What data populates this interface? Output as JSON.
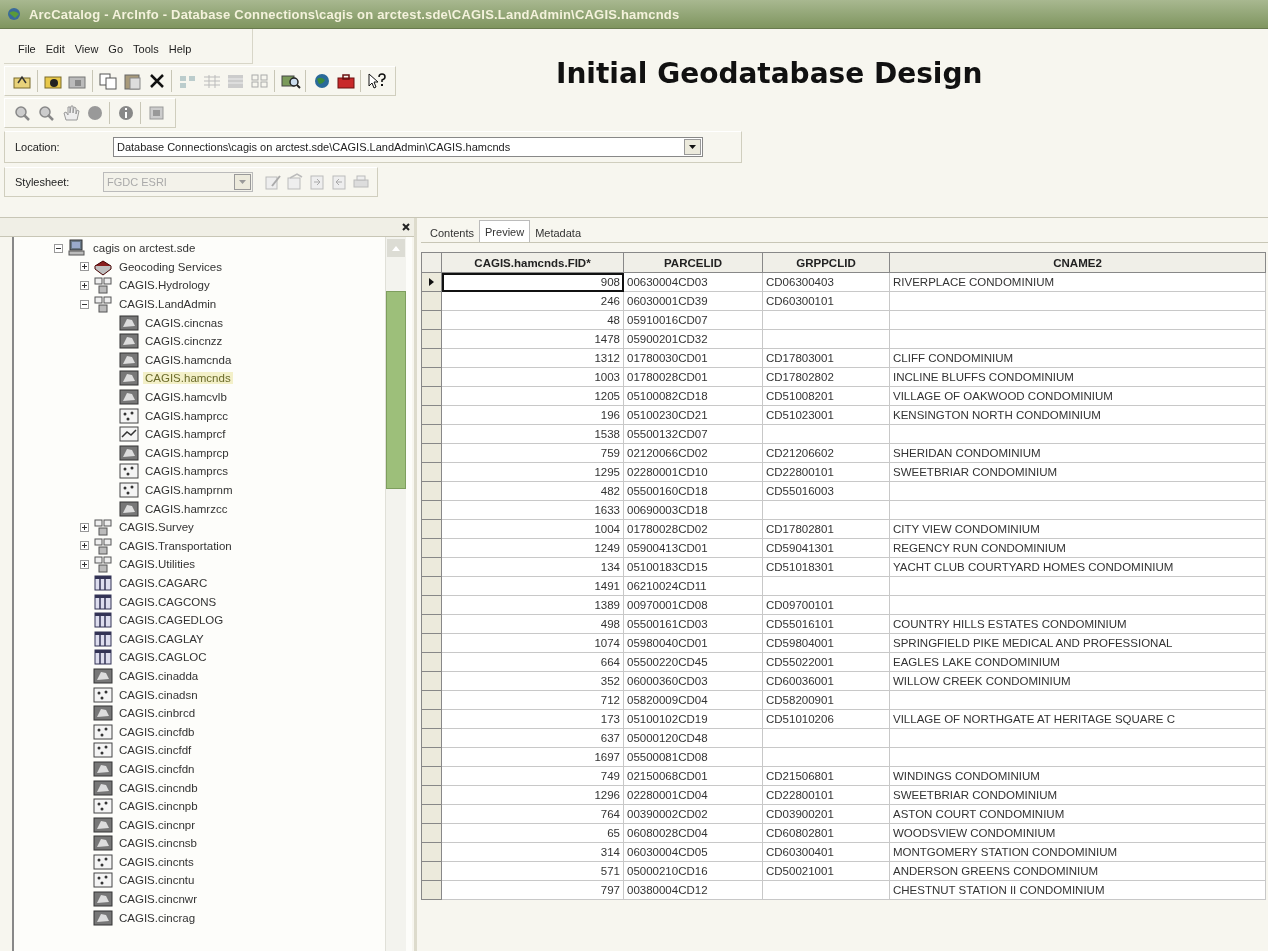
{
  "window": {
    "title": "ArcCatalog - ArcInfo - Database Connections\\cagis on arctest.sde\\CAGIS.LandAdmin\\CAGIS.hamcnds"
  },
  "menu": [
    "File",
    "Edit",
    "View",
    "Go",
    "Tools",
    "Help"
  ],
  "overlay_title": "Initial Geodatabase Design",
  "location": {
    "label": "Location:",
    "value": "Database Connections\\cagis on arctest.sde\\CAGIS.LandAdmin\\CAGIS.hamcnds"
  },
  "stylesheet": {
    "label": "Stylesheet:",
    "value": "FGDC ESRI",
    "disabled": true
  },
  "tree": {
    "label": "cagis on arctest.sde",
    "kind": "connection",
    "expanded": true,
    "selected": false,
    "children": [
      {
        "label": "Geocoding Services",
        "kind": "geocoding",
        "expanded": false,
        "selected": false
      },
      {
        "label": "CAGIS.Hydrology",
        "kind": "dataset",
        "expanded": false,
        "selected": false
      },
      {
        "label": "CAGIS.LandAdmin",
        "kind": "dataset",
        "expanded": true,
        "selected": false,
        "children": [
          {
            "label": "CAGIS.cincnas",
            "kind": "polygon",
            "selected": false
          },
          {
            "label": "CAGIS.cincnzz",
            "kind": "polygon",
            "selected": false
          },
          {
            "label": "CAGIS.hamcnda",
            "kind": "polygon",
            "selected": false
          },
          {
            "label": "CAGIS.hamcnds",
            "kind": "polygon",
            "selected": true
          },
          {
            "label": "CAGIS.hamcvlb",
            "kind": "polygon",
            "selected": false
          },
          {
            "label": "CAGIS.hamprcc",
            "kind": "point",
            "selected": false
          },
          {
            "label": "CAGIS.hamprcf",
            "kind": "line",
            "selected": false
          },
          {
            "label": "CAGIS.hamprcp",
            "kind": "polygon",
            "selected": false
          },
          {
            "label": "CAGIS.hamprcs",
            "kind": "point",
            "selected": false
          },
          {
            "label": "CAGIS.hamprnm",
            "kind": "point",
            "selected": false
          },
          {
            "label": "CAGIS.hamrzcc",
            "kind": "polygon",
            "selected": false
          }
        ]
      },
      {
        "label": "CAGIS.Survey",
        "kind": "dataset",
        "expanded": false,
        "selected": false
      },
      {
        "label": "CAGIS.Transportation",
        "kind": "dataset",
        "expanded": false,
        "selected": false
      },
      {
        "label": "CAGIS.Utilities",
        "kind": "dataset",
        "expanded": false,
        "selected": false
      },
      {
        "label": "CAGIS.CAGARC",
        "kind": "table",
        "selected": false
      },
      {
        "label": "CAGIS.CAGCONS",
        "kind": "table",
        "selected": false
      },
      {
        "label": "CAGIS.CAGEDLOG",
        "kind": "table",
        "selected": false
      },
      {
        "label": "CAGIS.CAGLAY",
        "kind": "table",
        "selected": false
      },
      {
        "label": "CAGIS.CAGLOC",
        "kind": "table",
        "selected": false
      },
      {
        "label": "CAGIS.cinadda",
        "kind": "polygon",
        "selected": false
      },
      {
        "label": "CAGIS.cinadsn",
        "kind": "point",
        "selected": false
      },
      {
        "label": "CAGIS.cinbrcd",
        "kind": "polygon",
        "selected": false
      },
      {
        "label": "CAGIS.cincfdb",
        "kind": "point",
        "selected": false
      },
      {
        "label": "CAGIS.cincfdf",
        "kind": "point",
        "selected": false
      },
      {
        "label": "CAGIS.cincfdn",
        "kind": "polygon",
        "selected": false
      },
      {
        "label": "CAGIS.cincndb",
        "kind": "polygon",
        "selected": false
      },
      {
        "label": "CAGIS.cincnpb",
        "kind": "point",
        "selected": false
      },
      {
        "label": "CAGIS.cincnpr",
        "kind": "polygon",
        "selected": false
      },
      {
        "label": "CAGIS.cincnsb",
        "kind": "polygon",
        "selected": false
      },
      {
        "label": "CAGIS.cincnts",
        "kind": "point",
        "selected": false
      },
      {
        "label": "CAGIS.cincntu",
        "kind": "point",
        "selected": false
      },
      {
        "label": "CAGIS.cincnwr",
        "kind": "polygon",
        "selected": false
      },
      {
        "label": "CAGIS.cincrag",
        "kind": "polygon",
        "selected": false
      }
    ]
  },
  "tabs": [
    {
      "label": "Contents",
      "selected": false
    },
    {
      "label": "Preview",
      "selected": true
    },
    {
      "label": "Metadata",
      "selected": false
    }
  ],
  "table": {
    "columns": [
      "CAGIS.hamcnds.FID*",
      "PARCELID",
      "GRPPCLID",
      "CNAME2"
    ],
    "rows": [
      {
        "current": true,
        "cells": [
          "908",
          "00630004CD03",
          "CD06300403",
          "RIVERPLACE CONDOMINIUM"
        ]
      },
      {
        "current": false,
        "cells": [
          "246",
          "06030001CD39",
          "CD60300101",
          null
        ]
      },
      {
        "current": false,
        "cells": [
          "48",
          "05910016CD07",
          null,
          null
        ]
      },
      {
        "current": false,
        "cells": [
          "1478",
          "05900201CD32",
          null,
          null
        ]
      },
      {
        "current": false,
        "cells": [
          "1312",
          "01780030CD01",
          "CD17803001",
          "CLIFF CONDOMINIUM"
        ]
      },
      {
        "current": false,
        "cells": [
          "1003",
          "01780028CD01",
          "CD17802802",
          "INCLINE BLUFFS CONDOMINIUM"
        ]
      },
      {
        "current": false,
        "cells": [
          "1205",
          "05100082CD18",
          "CD51008201",
          "VILLAGE OF OAKWOOD CONDOMINIUM"
        ]
      },
      {
        "current": false,
        "cells": [
          "196",
          "05100230CD21",
          "CD51023001",
          "KENSINGTON NORTH CONDOMINIUM"
        ]
      },
      {
        "current": false,
        "cells": [
          "1538",
          "05500132CD07",
          null,
          null
        ]
      },
      {
        "current": false,
        "cells": [
          "759",
          "02120066CD02",
          "CD21206602",
          "SHERIDAN CONDOMINIUM"
        ]
      },
      {
        "current": false,
        "cells": [
          "1295",
          "02280001CD10",
          "CD22800101",
          "SWEETBRIAR CONDOMINIUM"
        ]
      },
      {
        "current": false,
        "cells": [
          "482",
          "05500160CD18",
          "CD55016003",
          null
        ]
      },
      {
        "current": false,
        "cells": [
          "1633",
          "00690003CD18",
          null,
          null
        ]
      },
      {
        "current": false,
        "cells": [
          "1004",
          "01780028CD02",
          "CD17802801",
          "CITY VIEW CONDOMINIUM"
        ]
      },
      {
        "current": false,
        "cells": [
          "1249",
          "05900413CD01",
          "CD59041301",
          "REGENCY RUN CONDOMINIUM"
        ]
      },
      {
        "current": false,
        "cells": [
          "134",
          "05100183CD15",
          "CD51018301",
          "YACHT CLUB COURTYARD HOMES CONDOMINIUM"
        ]
      },
      {
        "current": false,
        "cells": [
          "1491",
          "06210024CD11",
          null,
          null
        ]
      },
      {
        "current": false,
        "cells": [
          "1389",
          "00970001CD08",
          "CD09700101",
          null
        ]
      },
      {
        "current": false,
        "cells": [
          "498",
          "05500161CD03",
          "CD55016101",
          "COUNTRY HILLS ESTATES CONDOMINIUM"
        ]
      },
      {
        "current": false,
        "cells": [
          "1074",
          "05980040CD01",
          "CD59804001",
          "SPRINGFIELD PIKE MEDICAL AND PROFESSIONAL"
        ]
      },
      {
        "current": false,
        "cells": [
          "664",
          "05500220CD45",
          "CD55022001",
          "EAGLES LAKE CONDOMINIUM"
        ]
      },
      {
        "current": false,
        "cells": [
          "352",
          "06000360CD03",
          "CD60036001",
          "WILLOW CREEK CONDOMINIUM"
        ]
      },
      {
        "current": false,
        "cells": [
          "712",
          "05820009CD04",
          "CD58200901",
          null
        ]
      },
      {
        "current": false,
        "cells": [
          "173",
          "05100102CD19",
          "CD51010206",
          "VILLAGE OF NORTHGATE AT HERITAGE SQUARE C"
        ]
      },
      {
        "current": false,
        "cells": [
          "637",
          "05000120CD48",
          null,
          null
        ]
      },
      {
        "current": false,
        "cells": [
          "1697",
          "05500081CD08",
          null,
          null
        ]
      },
      {
        "current": false,
        "cells": [
          "749",
          "02150068CD01",
          "CD21506801",
          "WINDINGS CONDOMINIUM"
        ]
      },
      {
        "current": false,
        "cells": [
          "1296",
          "02280001CD04",
          "CD22800101",
          "SWEETBRIAR CONDOMINIUM"
        ]
      },
      {
        "current": false,
        "cells": [
          "764",
          "00390002CD02",
          "CD03900201",
          "ASTON COURT CONDOMINIUM"
        ]
      },
      {
        "current": false,
        "cells": [
          "65",
          "06080028CD04",
          "CD60802801",
          "WOODSVIEW CONDOMINIUM"
        ]
      },
      {
        "current": false,
        "cells": [
          "314",
          "06030004CD05",
          "CD60300401",
          "MONTGOMERY STATION CONDOMINIUM"
        ]
      },
      {
        "current": false,
        "cells": [
          "571",
          "05000210CD16",
          "CD50021001",
          "ANDERSON GREENS CONDOMINIUM"
        ]
      },
      {
        "current": false,
        "cells": [
          "797",
          "00380004CD12",
          null,
          "CHESTNUT STATION II CONDOMINIUM"
        ]
      }
    ]
  }
}
